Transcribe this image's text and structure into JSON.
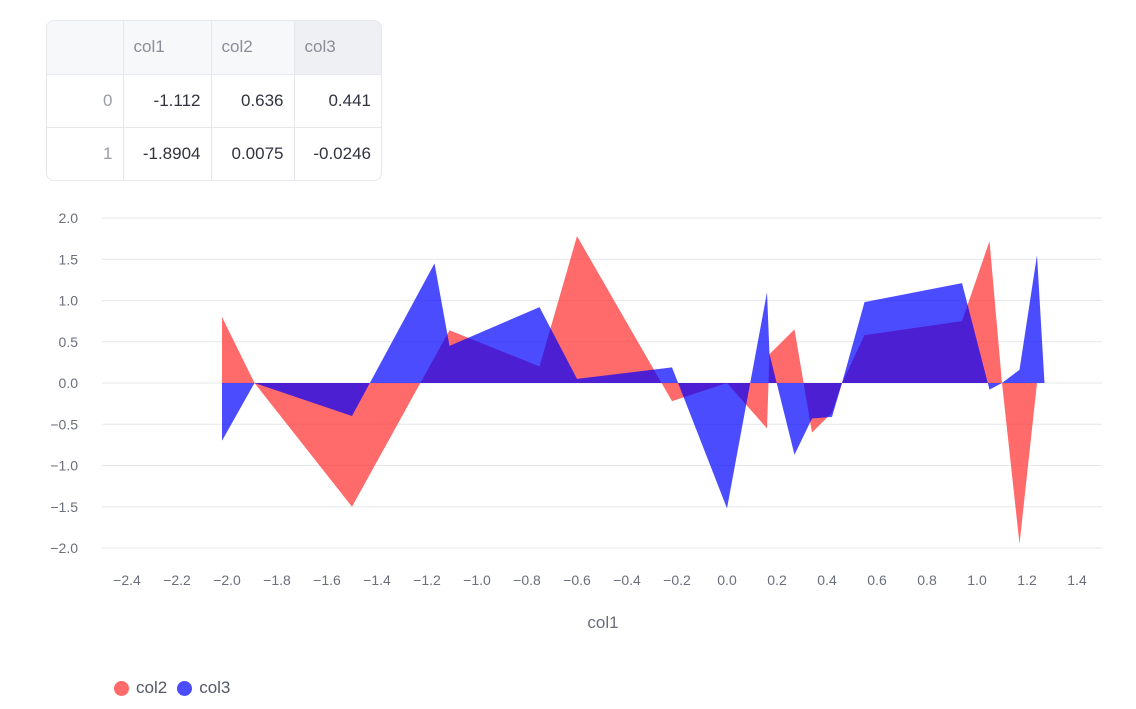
{
  "table": {
    "columns": [
      "",
      "col1",
      "col2",
      "col3"
    ],
    "rows": [
      {
        "index": "0",
        "cells": [
          "-1.112",
          "0.636",
          "0.441"
        ]
      },
      {
        "index": "1",
        "cells": [
          "-1.8904",
          "0.0075",
          "-0.0246"
        ]
      }
    ]
  },
  "chart_data": {
    "type": "area",
    "xlabel": "col1",
    "ylabel": "",
    "xlim": [
      -2.5,
      1.5
    ],
    "ylim": [
      -2.0,
      2.0
    ],
    "x_ticks": [
      "−2.4",
      "−2.2",
      "−2.0",
      "−1.8",
      "−1.6",
      "−1.4",
      "−1.2",
      "−1.0",
      "−0.8",
      "−0.6",
      "−0.4",
      "−0.2",
      "0.0",
      "0.2",
      "0.4",
      "0.6",
      "0.8",
      "1.0",
      "1.2",
      "1.4"
    ],
    "y_ticks": [
      "2.0",
      "1.5",
      "1.0",
      "0.5",
      "0.0",
      "−0.5",
      "−1.0",
      "−1.5",
      "−2.0"
    ],
    "grid": "horizontal",
    "legend_position": "bottom-left",
    "series": [
      {
        "name": "col2",
        "color": "#ff2b2b",
        "x": [
          -2.02,
          -1.89,
          -1.5,
          -1.11,
          -0.75,
          -0.6,
          -0.22,
          -0.17,
          0.0,
          0.16,
          0.17,
          0.27,
          0.34,
          0.42,
          0.46,
          0.55,
          0.94,
          1.05,
          1.1,
          1.17,
          1.24,
          1.27
        ],
        "y": [
          0.8,
          0.0,
          -1.5,
          0.64,
          0.2,
          1.78,
          -0.22,
          -0.17,
          0.0,
          -0.55,
          0.35,
          0.65,
          -0.6,
          -0.36,
          0.0,
          0.58,
          0.75,
          1.72,
          0.0,
          -1.95,
          0.0,
          0.0
        ]
      },
      {
        "name": "col3",
        "color": "#0000ff",
        "x": [
          -2.02,
          -1.89,
          -1.5,
          -1.17,
          -1.11,
          -0.75,
          -0.6,
          -0.22,
          0.0,
          0.16,
          0.17,
          0.27,
          0.34,
          0.42,
          0.46,
          0.55,
          0.94,
          1.05,
          1.1,
          1.17,
          1.24,
          1.27
        ],
        "y": [
          -0.7,
          0.0,
          -0.4,
          1.45,
          0.45,
          0.92,
          0.05,
          0.19,
          -1.52,
          1.1,
          0.35,
          -0.87,
          -0.43,
          -0.41,
          0.0,
          0.98,
          1.21,
          -0.08,
          0.0,
          0.16,
          1.55,
          0.0
        ]
      }
    ]
  }
}
